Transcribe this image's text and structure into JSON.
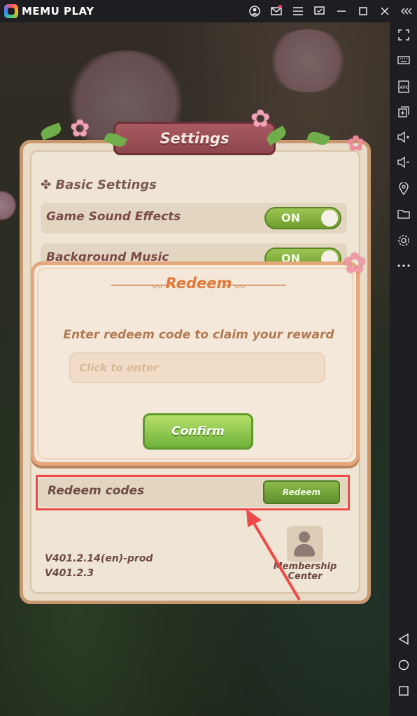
{
  "app": {
    "name": "MEMU PLAY"
  },
  "topbar": {
    "icons": [
      "account-icon",
      "mail-icon",
      "menu-icon",
      "screen-icon",
      "minimize-icon",
      "maximize-icon",
      "close-icon",
      "collapse-icon"
    ]
  },
  "sidebar": {
    "icons": [
      "fullscreen-icon",
      "keyboard-icon",
      "apk-icon",
      "multi-window-icon",
      "volume-up-icon",
      "volume-down-icon",
      "location-icon",
      "folder-icon",
      "settings-icon",
      "more-icon",
      "back-icon",
      "home-icon",
      "recents-icon"
    ]
  },
  "settings": {
    "title": "Settings",
    "section_title": "Basic Settings",
    "rows": [
      {
        "label": "Game Sound Effects",
        "toggle": "ON"
      },
      {
        "label": "Background Music",
        "toggle": "ON"
      }
    ],
    "redeem_row": {
      "label": "Redeem codes",
      "button": "Redeem"
    },
    "version_lines": [
      "V401.2.14(en)-prod",
      "V401.2.3"
    ],
    "membership": "Membership Center"
  },
  "dialog": {
    "title": "Redeem",
    "prompt": "Enter redeem code to claim your reward",
    "input_placeholder": "Click to enter",
    "input_value": "",
    "confirm": "Confirm"
  },
  "colors": {
    "highlight": "#ee4a4a",
    "confirm_green": "#6fb23a",
    "title_orange": "#e07b3a",
    "banner": "#8e454d"
  }
}
